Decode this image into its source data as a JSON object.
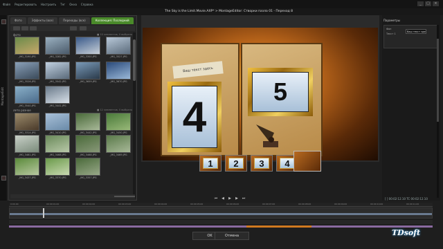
{
  "menu": [
    "Файл",
    "Редактировать",
    "Настроить",
    "Тег",
    "Окна",
    "Справка"
  ],
  "window": {
    "title": "The Sky is the Limit.Movie.AXP* > MontageEditor: Створки пазла 01 - Переход 8"
  },
  "sidebar_label": "Montage/Edit",
  "library": {
    "tabs": [
      "Фото",
      "Эффекты (все)",
      "Переходы (все)",
      "Коллекция: Последний"
    ],
    "active_tab": 3,
    "sections": [
      {
        "label": "фото",
        "count": "■ 10 элементов, 0 выбрано"
      },
      {
        "label": "лето разное",
        "count": "■ 12 элементов, 0 выбрано"
      }
    ],
    "thumbs": [
      "_MG_3190.JPG",
      "_MG_3282.JPG",
      "_MG_3300.JPG",
      "_MG_3527.JPG",
      "_MG_3526.JPG",
      "_MG_3542.JPG",
      "_MG_3659.JPG",
      "_MG_3670.JPG",
      "_MG_3540.JPG",
      "_MG_3441.JPG",
      "_MG_3314.JPG",
      "_MG_3410.JPG",
      "_MG_3442.JPG",
      "_MG_3450.JPG",
      "_MG_3461.JPG",
      "_MG_3468.JPG",
      "_MG_3468.JPG",
      "_MG_3469.JPG",
      "_MG_3437.JPG",
      "_MG_3370.JPG",
      "_MG_3357.JPG"
    ]
  },
  "preview": {
    "note_text": "Ваш текст здесь",
    "left_number": "4",
    "right_number": "5"
  },
  "tiles": [
    "1",
    "2",
    "3",
    "4"
  ],
  "right_panel": {
    "header": "Параметры",
    "field1_label": "Фон",
    "field2_label": "Текст 1",
    "text_value": "Ваш текст здесь"
  },
  "timeline": {
    "timecode": "[ ] 00:02:12.10    TC 00:02:12.10",
    "ruler": [
      "0:00.00",
      "00:00:01.00",
      "00:00:02.00",
      "00:00:03.00",
      "00:00:04.00",
      "00:00:05.00",
      "00:00:06.00",
      "00:00:07.00",
      "00:00:08.00",
      "00:00:09.00",
      "00:00:10.00",
      "00:00:11.00"
    ]
  },
  "buttons": {
    "ok": "OK",
    "cancel": "Отмена"
  },
  "watermark": {
    "main": "TDsoft",
    "sub": ""
  }
}
